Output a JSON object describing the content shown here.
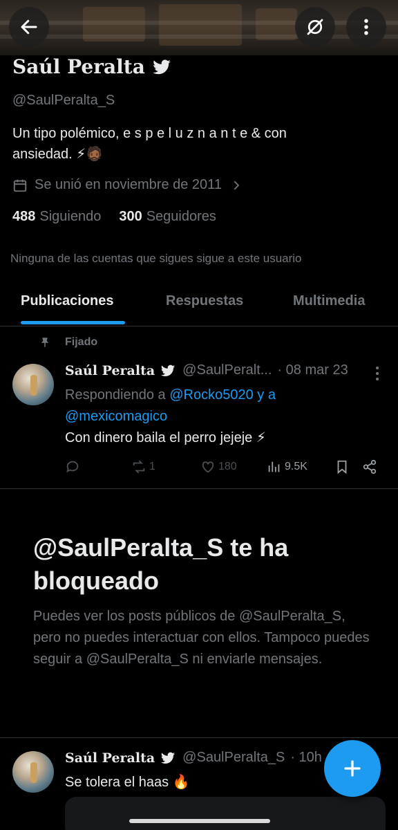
{
  "profile": {
    "name": "Saúl Peralta",
    "handle": "@SaulPeralta_S",
    "bio_line1": "Un tipo polémico, e s p e l u z n a n t e & con",
    "bio_line2": "ansiedad. ⚡🧔🏾",
    "joined": "Se unió en noviembre de 2011",
    "following_count": "488",
    "following_label": "Siguiendo",
    "followers_count": "300",
    "followers_label": "Seguidores",
    "mutuals": "Ninguna de las cuentas que sigues sigue a este usuario"
  },
  "tabs": [
    {
      "label": "Publicaciones",
      "active": true
    },
    {
      "label": "Respuestas",
      "active": false
    },
    {
      "label": "Multimedia",
      "active": false
    }
  ],
  "pinned_tweet": {
    "pinned_label": "Fijado",
    "name": "Saúl Peralta",
    "handle": "@SaulPeralt...",
    "date": "· 08 mar 23",
    "reply_prefix": "Respondiendo a",
    "reply_user1": "@Rocko5020",
    "reply_and": "y a",
    "reply_user2": "@mexicomagico",
    "text": "Con dinero baila el perro jejeje ⚡",
    "retweets": "1",
    "likes": "180",
    "views": "9.5K"
  },
  "blocked": {
    "title": "@SaulPeralta_S te ha bloqueado",
    "text": "Puedes ver los posts públicos de @SaulPeralta_S, pero no puedes interactuar con ellos. Tampoco puedes seguir a @SaulPeralta_S ni enviarle mensajes."
  },
  "second_tweet": {
    "name": "Saúl Peralta",
    "handle": "@SaulPeralta_S",
    "time": "· 10h",
    "text": "Se tolera el haas 🔥"
  },
  "colors": {
    "accent": "#1d9bf0",
    "muted": "#71767b",
    "text": "#e7e9ea",
    "background": "#000000"
  },
  "icons": [
    "back-arrow-icon",
    "grok-icon",
    "more-vertical-icon",
    "twitter-bird-icon",
    "calendar-icon",
    "chevron-right-icon",
    "pin-icon",
    "reply-icon",
    "retweet-icon",
    "like-icon",
    "views-icon",
    "bookmark-icon",
    "share-icon",
    "plus-icon"
  ]
}
